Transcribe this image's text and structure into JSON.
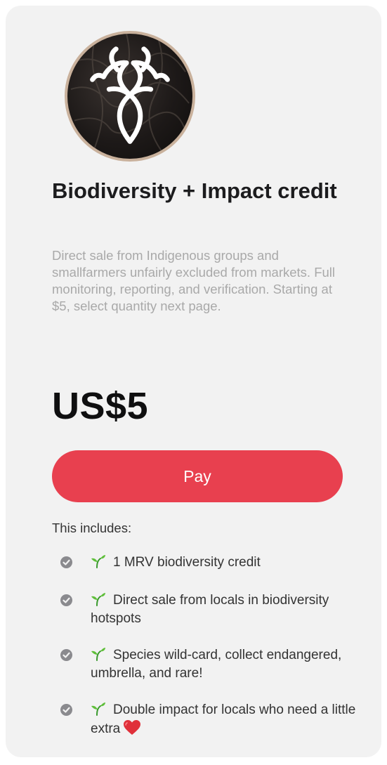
{
  "product": {
    "logo_icon": "tree-roots-logo",
    "title": "Biodiversity + Impact credit",
    "description": "Direct sale from Indigenous groups and smallfarmers unfairly excluded from markets. Full monitoring, reporting, and verification. Starting at $5, select quantity next page.",
    "price": "US$5"
  },
  "checkout": {
    "pay_label": "Pay",
    "accent_color": "#e8404f"
  },
  "includes": {
    "heading": "This includes:",
    "bullet_icon": "check-circle-icon",
    "item_icon": "seedling-icon",
    "items": [
      {
        "text": "1 MRV biodiversity credit"
      },
      {
        "text": "Direct sale from locals in biodiversity hotspots"
      },
      {
        "text": "Species wild-card, collect endangered, umbrella, and rare!"
      },
      {
        "text": "Double impact for locals who need a little extra",
        "trailing_icon": "red-heart-icon"
      }
    ]
  }
}
